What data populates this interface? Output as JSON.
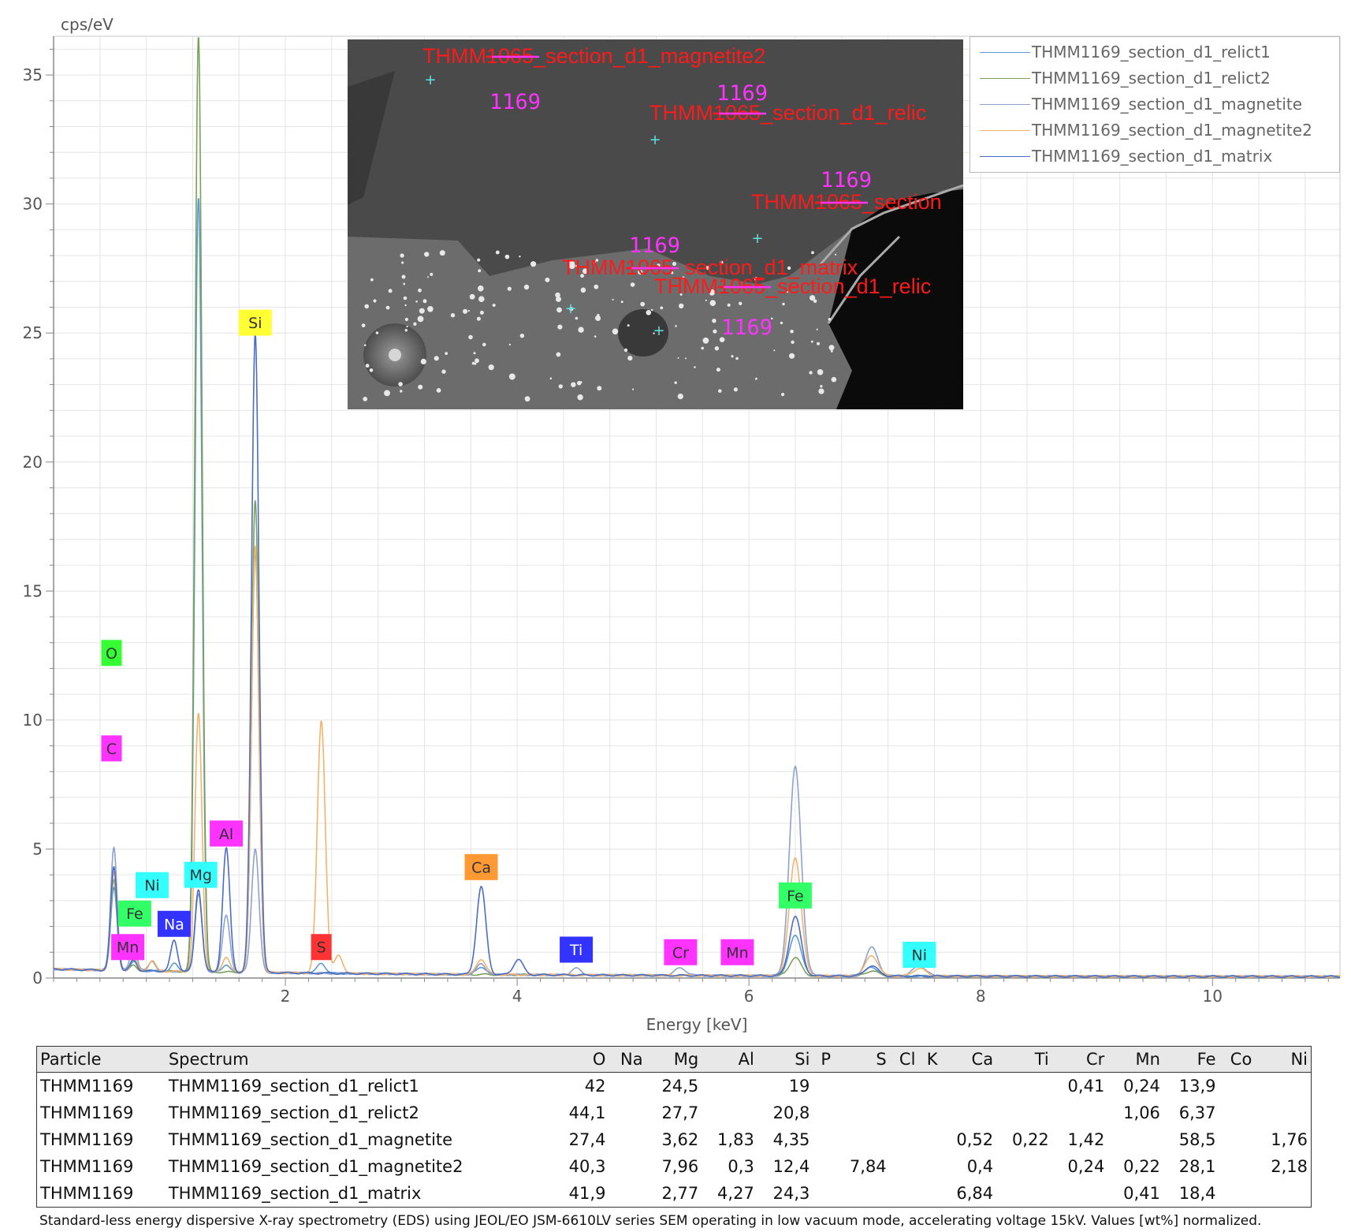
{
  "chart_data": {
    "type": "line",
    "ylabel": "cps/eV",
    "xlabel": "Energy [keV]",
    "xlim": [
      0.0,
      11.1
    ],
    "ylim": [
      0,
      36.5
    ],
    "x_ticks": [
      2,
      4,
      6,
      8,
      10
    ],
    "y_ticks": [
      0,
      5,
      10,
      15,
      20,
      25,
      30,
      35
    ],
    "grid": true,
    "legend_position": "top-right",
    "series": [
      {
        "name": "THMM1169_section_d1_relict1",
        "color": "#5b9bd5",
        "peaks": [
          [
            0.52,
            3.2
          ],
          [
            0.69,
            0.35
          ],
          [
            1.04,
            0.3
          ],
          [
            1.25,
            30
          ],
          [
            1.49,
            0.3
          ],
          [
            1.74,
            16.3
          ],
          [
            2.31,
            0.4
          ],
          [
            3.69,
            0.3
          ],
          [
            6.4,
            1.6
          ],
          [
            7.06,
            0.35
          ]
        ]
      },
      {
        "name": "THMM1169_section_d1_relict2",
        "color": "#7aa05a",
        "peaks": [
          [
            0.52,
            3.5
          ],
          [
            0.69,
            0.2
          ],
          [
            1.25,
            36.3
          ],
          [
            1.74,
            18.3
          ],
          [
            6.4,
            0.7
          ],
          [
            7.06,
            0.2
          ]
        ]
      },
      {
        "name": "THMM1169_section_d1_magnetite",
        "color": "#8da2cf",
        "peaks": [
          [
            0.52,
            4.8
          ],
          [
            0.69,
            1.0
          ],
          [
            0.85,
            0.4
          ],
          [
            1.25,
            3.0
          ],
          [
            1.49,
            2.2
          ],
          [
            1.74,
            4.8
          ],
          [
            3.69,
            0.4
          ],
          [
            4.51,
            0.25
          ],
          [
            5.41,
            0.3
          ],
          [
            6.4,
            8.1
          ],
          [
            7.06,
            1.1
          ],
          [
            7.47,
            0.4
          ]
        ]
      },
      {
        "name": "THMM1169_section_d1_magnetite2",
        "color": "#f4b36b",
        "peaks": [
          [
            0.52,
            3.8
          ],
          [
            0.69,
            0.5
          ],
          [
            0.85,
            0.4
          ],
          [
            1.25,
            10.0
          ],
          [
            1.49,
            0.6
          ],
          [
            1.74,
            16.5
          ],
          [
            2.31,
            9.8
          ],
          [
            2.46,
            0.7
          ],
          [
            3.69,
            0.6
          ],
          [
            6.4,
            4.6
          ],
          [
            7.06,
            0.8
          ],
          [
            7.47,
            0.3
          ]
        ]
      },
      {
        "name": "THMM1169_section_d1_matrix",
        "color": "#4a6cc4",
        "peaks": [
          [
            0.52,
            4.0
          ],
          [
            0.69,
            0.4
          ],
          [
            1.04,
            1.2
          ],
          [
            1.25,
            3.2
          ],
          [
            1.49,
            4.8
          ],
          [
            1.74,
            24.8
          ],
          [
            3.69,
            3.4
          ],
          [
            4.01,
            0.6
          ],
          [
            6.4,
            2.3
          ],
          [
            7.06,
            0.4
          ]
        ]
      }
    ],
    "element_labels": [
      {
        "text": "Si",
        "x": 1.74,
        "y": 25.4,
        "bg": "#ffff33",
        "fg": "#333333"
      },
      {
        "text": "Al",
        "x": 1.49,
        "y": 5.6,
        "bg": "#ff33ff",
        "fg": "#333333"
      },
      {
        "text": "Mg",
        "x": 1.27,
        "y": 4.0,
        "bg": "#33ffff",
        "fg": "#333333"
      },
      {
        "text": "Ni",
        "x": 0.85,
        "y": 3.6,
        "bg": "#33ffff",
        "fg": "#333333"
      },
      {
        "text": "Na",
        "x": 1.04,
        "y": 2.1,
        "bg": "#3333ff",
        "fg": "#ffffff"
      },
      {
        "text": "Fe",
        "x": 0.7,
        "y": 2.5,
        "bg": "#33ff66",
        "fg": "#333333"
      },
      {
        "text": "Mn",
        "x": 0.64,
        "y": 1.2,
        "bg": "#ff33ff",
        "fg": "#333333"
      },
      {
        "text": "S",
        "x": 2.31,
        "y": 1.2,
        "bg": "#ff3333",
        "fg": "#333333"
      },
      {
        "text": "Ca",
        "x": 3.69,
        "y": 4.3,
        "bg": "#ff9933",
        "fg": "#333333"
      },
      {
        "text": "Ti",
        "x": 4.51,
        "y": 1.1,
        "bg": "#3333ff",
        "fg": "#ffffff"
      },
      {
        "text": "Cr",
        "x": 5.41,
        "y": 1.0,
        "bg": "#ff33ff",
        "fg": "#333333"
      },
      {
        "text": "Mn",
        "x": 5.9,
        "y": 1.0,
        "bg": "#ff33ff",
        "fg": "#333333"
      },
      {
        "text": "Fe",
        "x": 6.4,
        "y": 3.2,
        "bg": "#33ff66",
        "fg": "#333333"
      },
      {
        "text": "Ni",
        "x": 7.47,
        "y": 0.9,
        "bg": "#33ffff",
        "fg": "#333333"
      },
      {
        "text": "O",
        "x": 0.5,
        "y": 12.6,
        "bg": "#33ff33",
        "fg": "#333333"
      },
      {
        "text": "C",
        "x": 0.5,
        "y": 8.9,
        "bg": "#ff33ff",
        "fg": "#333333"
      }
    ]
  },
  "sem_image": {
    "annotations": [
      {
        "prefix": "THMM",
        "struck": "1065",
        "suffix": "_section_d1_magnetite2",
        "fix": "1169"
      },
      {
        "prefix": "THMM",
        "struck": "1065",
        "suffix": "_section_d1_relic",
        "fix": "1169"
      },
      {
        "prefix": "THMM",
        "struck": "1065",
        "suffix": "_section",
        "fix": "1169"
      },
      {
        "prefix": "THMM",
        "struck": "1065",
        "suffix": "_section_d1_matrix",
        "fix": "1169"
      },
      {
        "prefix": "THMM",
        "struck": "1065",
        "suffix": "_section_d1_relic",
        "fix": "1169"
      }
    ]
  },
  "table": {
    "headers": [
      "Particle",
      "Spectrum",
      "O",
      "Na",
      "Mg",
      "Al",
      "Si",
      "P",
      "S",
      "Cl",
      "K",
      "Ca",
      "Ti",
      "Cr",
      "Mn",
      "Fe",
      "Co",
      "Ni"
    ],
    "rows": [
      [
        "THMM1169",
        "THMM1169_section_d1_relict1",
        "42",
        "",
        "24,5",
        "",
        "19",
        "",
        "",
        "",
        "",
        "",
        "",
        "0,41",
        "0,24",
        "13,9",
        "",
        ""
      ],
      [
        "THMM1169",
        "THMM1169_section_d1_relict2",
        "44,1",
        "",
        "27,7",
        "",
        "20,8",
        "",
        "",
        "",
        "",
        "",
        "",
        "",
        "1,06",
        "6,37",
        "",
        ""
      ],
      [
        "THMM1169",
        "THMM1169_section_d1_magnetite",
        "27,4",
        "",
        "3,62",
        "1,83",
        "4,35",
        "",
        "",
        "",
        "",
        "0,52",
        "0,22",
        "1,42",
        "",
        "58,5",
        "",
        "1,76"
      ],
      [
        "THMM1169",
        "THMM1169_section_d1_magnetite2",
        "40,3",
        "",
        "7,96",
        "0,3",
        "12,4",
        "",
        "7,84",
        "",
        "",
        "0,4",
        "",
        "0,24",
        "0,22",
        "28,1",
        "",
        "2,18"
      ],
      [
        "THMM1169",
        "THMM1169_section_d1_matrix",
        "41,9",
        "",
        "2,77",
        "4,27",
        "24,3",
        "",
        "",
        "",
        "",
        "6,84",
        "",
        "",
        "0,41",
        "18,4",
        "",
        ""
      ]
    ]
  },
  "footnote": "Standard-less energy dispersive X-ray spectrometry (EDS) using JEOL/EO JSM-6610LV series SEM operating in low vacuum mode, accelerating voltage 15kV. Values [wt%] normalized."
}
